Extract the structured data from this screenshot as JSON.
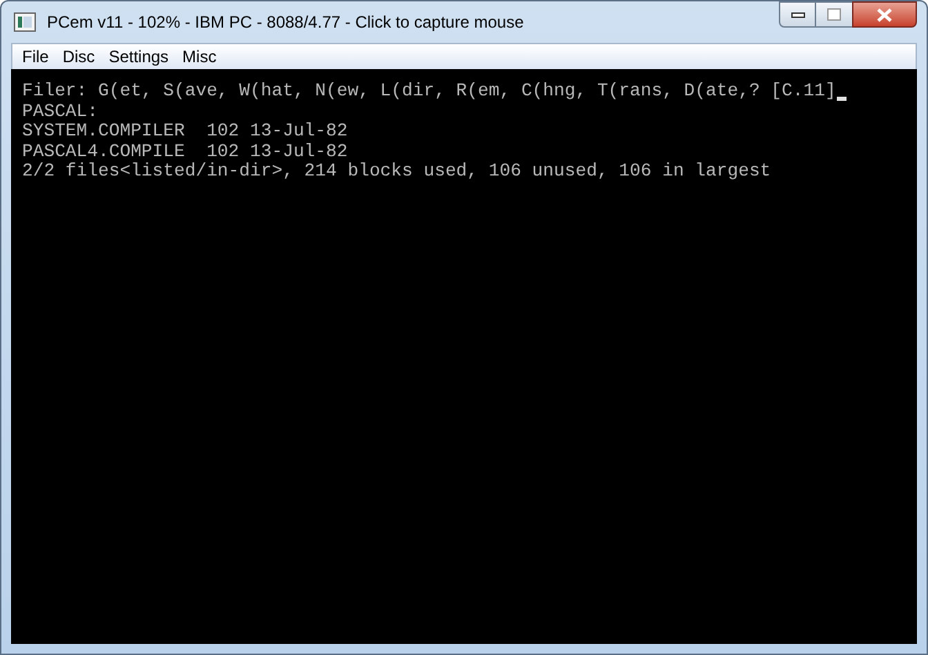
{
  "window": {
    "title": "PCem v11 - 102% - IBM PC - 8088/4.77 - Click to capture mouse"
  },
  "menu": [
    "File",
    "Disc",
    "Settings",
    "Misc"
  ],
  "screen": {
    "lines": [
      "Filer: G(et, S(ave, W(hat, N(ew, L(dir, R(em, C(hng, T(rans, D(ate,? [C.11]",
      "PASCAL:",
      "SYSTEM.COMPILER  102 13-Jul-82",
      "PASCAL4.COMPILE  102 13-Jul-82",
      "2/2 files<listed/in-dir>, 214 blocks used, 106 unused, 106 in largest"
    ],
    "cursor": true
  }
}
